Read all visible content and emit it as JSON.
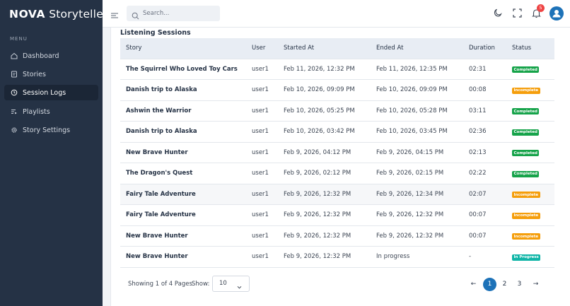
{
  "app": {
    "brand_bold": "NOVA",
    "brand_rest": "Storyteller"
  },
  "sidebar": {
    "menu_label": "MENU",
    "items": [
      {
        "label": "Dashboard",
        "icon": "home-icon"
      },
      {
        "label": "Stories",
        "icon": "book-icon"
      },
      {
        "label": "Session Logs",
        "icon": "history-icon",
        "active": true
      },
      {
        "label": "Playlists",
        "icon": "playlist-icon"
      },
      {
        "label": "Story Settings",
        "icon": "gear-icon"
      }
    ]
  },
  "topbar": {
    "search_placeholder": "Search...",
    "notifications_count": "5"
  },
  "main": {
    "section_title": "Listening Sessions",
    "columns": [
      "Story",
      "User",
      "Started At",
      "Ended At",
      "Duration",
      "Status"
    ],
    "rows": [
      {
        "story": "The Squirrel Who Loved Toy Cars",
        "user": "user1",
        "started": "Feb 11, 2026, 12:32 PM",
        "ended": "Feb 11, 2026, 12:35 PM",
        "duration": "02:31",
        "status": "Completed"
      },
      {
        "story": "Danish trip to Alaska",
        "user": "user1",
        "started": "Feb 10, 2026, 09:09 PM",
        "ended": "Feb 10, 2026, 09:09 PM",
        "duration": "00:08",
        "status": "Incomplete"
      },
      {
        "story": "Ashwin the Warrior",
        "user": "user1",
        "started": "Feb 10, 2026, 05:25 PM",
        "ended": "Feb 10, 2026, 05:28 PM",
        "duration": "03:11",
        "status": "Completed"
      },
      {
        "story": "Danish trip to Alaska",
        "user": "user1",
        "started": "Feb 10, 2026, 03:42 PM",
        "ended": "Feb 10, 2026, 03:45 PM",
        "duration": "02:36",
        "status": "Completed"
      },
      {
        "story": "New Brave Hunter",
        "user": "user1",
        "started": "Feb 9, 2026, 04:12 PM",
        "ended": "Feb 9, 2026, 04:15 PM",
        "duration": "02:13",
        "status": "Completed"
      },
      {
        "story": "The Dragon's Quest",
        "user": "user1",
        "started": "Feb 9, 2026, 02:12 PM",
        "ended": "Feb 9, 2026, 02:15 PM",
        "duration": "02:22",
        "status": "Completed"
      },
      {
        "story": "Fairy Tale Adventure",
        "user": "user1",
        "started": "Feb 9, 2026, 12:32 PM",
        "ended": "Feb 9, 2026, 12:34 PM",
        "duration": "02:07",
        "status": "Incomplete"
      },
      {
        "story": "Fairy Tale Adventure",
        "user": "user1",
        "started": "Feb 9, 2026, 12:32 PM",
        "ended": "Feb 9, 2026, 12:32 PM",
        "duration": "00:07",
        "status": "Incomplete"
      },
      {
        "story": "New Brave Hunter",
        "user": "user1",
        "started": "Feb 9, 2026, 12:32 PM",
        "ended": "Feb 9, 2026, 12:32 PM",
        "duration": "00:07",
        "status": "Incomplete"
      },
      {
        "story": "New Brave Hunter",
        "user": "user1",
        "started": "Feb 9, 2026, 12:32 PM",
        "ended": "In progress",
        "duration": "-",
        "status": "In Progress"
      }
    ],
    "highlighted_row": 6
  },
  "footer": {
    "showing_text": "Showing 1 of 4 Pages",
    "show_label": "Show:",
    "page_size": "10",
    "prev_glyph": "←",
    "next_glyph": "→",
    "pages": [
      "1",
      "2",
      "3"
    ],
    "current_page": "1"
  },
  "colors": {
    "sidebar_bg": "#253245",
    "accent": "#1d72b8",
    "completed": "#16a34a",
    "incomplete": "#f59e0b",
    "in_progress": "#10b5a7"
  }
}
